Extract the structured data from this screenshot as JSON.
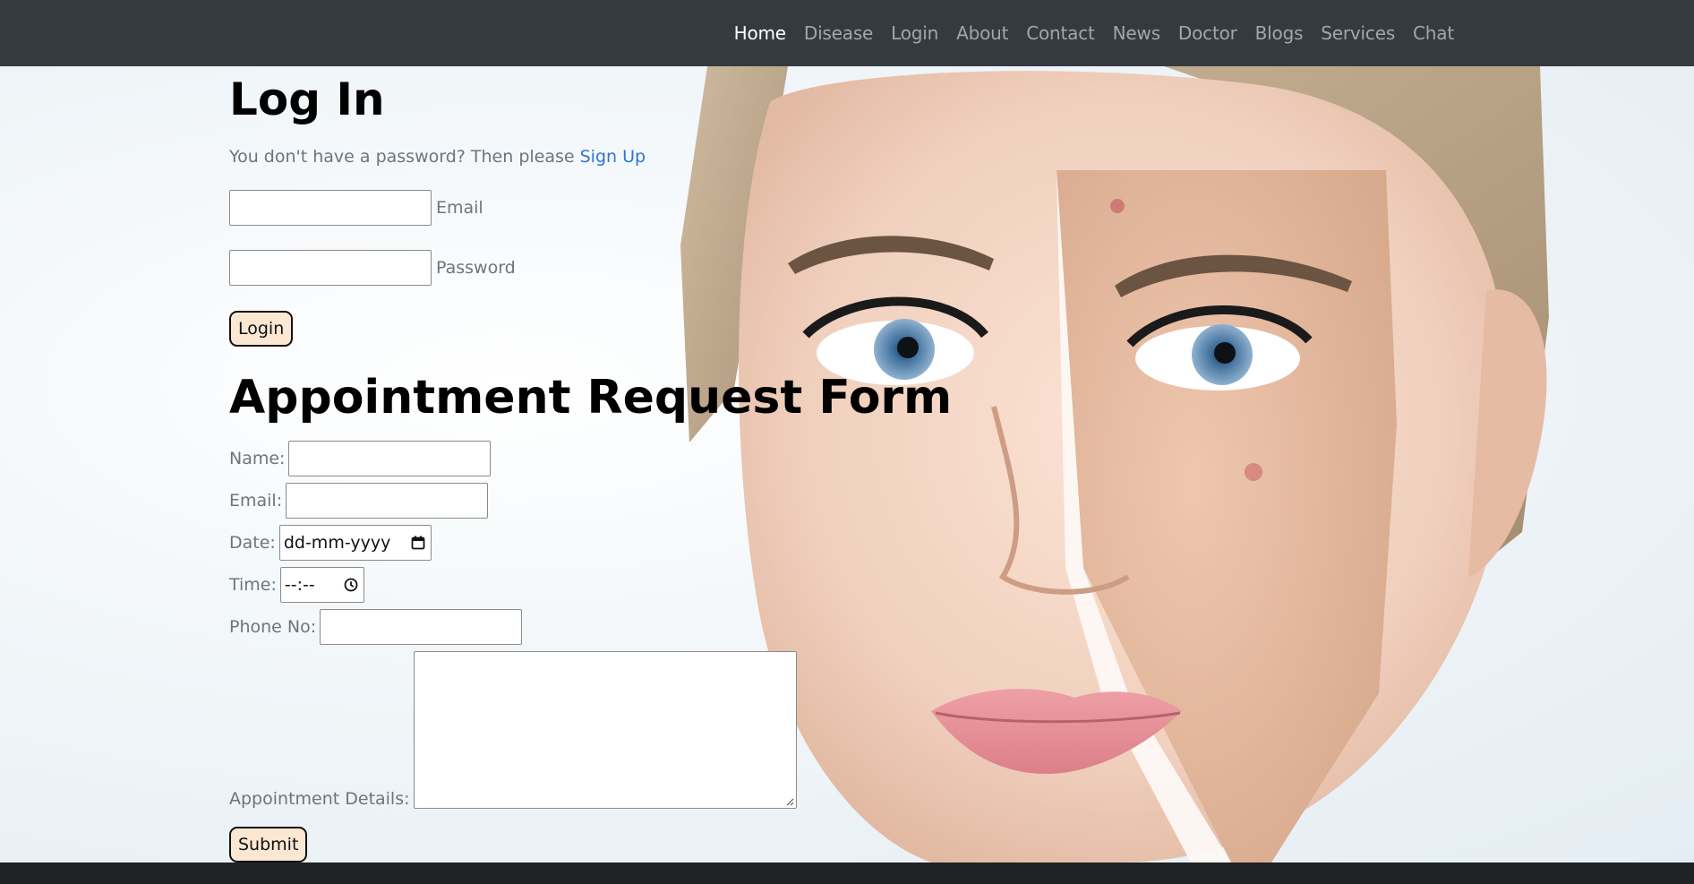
{
  "nav": {
    "items": [
      {
        "label": "Home",
        "active": true
      },
      {
        "label": "Disease",
        "active": false
      },
      {
        "label": "Login",
        "active": false
      },
      {
        "label": "About",
        "active": false
      },
      {
        "label": "Contact",
        "active": false
      },
      {
        "label": "News",
        "active": false
      },
      {
        "label": "Doctor",
        "active": false
      },
      {
        "label": "Blogs",
        "active": false
      },
      {
        "label": "Services",
        "active": false
      },
      {
        "label": "Chat",
        "active": false
      }
    ]
  },
  "login": {
    "title": "Log In",
    "signup_prompt": "You don't have a password? Then please ",
    "signup_link": "Sign Up",
    "email_label": "Email",
    "email_value": "",
    "password_label": "Password",
    "password_value": "",
    "button": "Login"
  },
  "appointment": {
    "title": "Appointment Request Form",
    "name_label": "Name:",
    "name_value": "",
    "email_label": "Email:",
    "email_value": "",
    "date_label": "Date:",
    "date_placeholder": "dd-mm-yyyy",
    "time_label": "Time:",
    "time_placeholder": "--:--",
    "phone_label": "Phone No:",
    "phone_value": "",
    "details_label": "Appointment Details:",
    "details_value": "",
    "submit": "Submit"
  },
  "icons": {
    "calendar": "calendar-icon",
    "clock": "clock-icon"
  },
  "colors": {
    "navbar": "#343a40",
    "nav_active": "#ffffff",
    "nav_inactive": "#a3a6a9",
    "link": "#2f76d2",
    "button_bg": "#fbe7d2",
    "label": "#6c757d",
    "footer": "#1f2123"
  }
}
